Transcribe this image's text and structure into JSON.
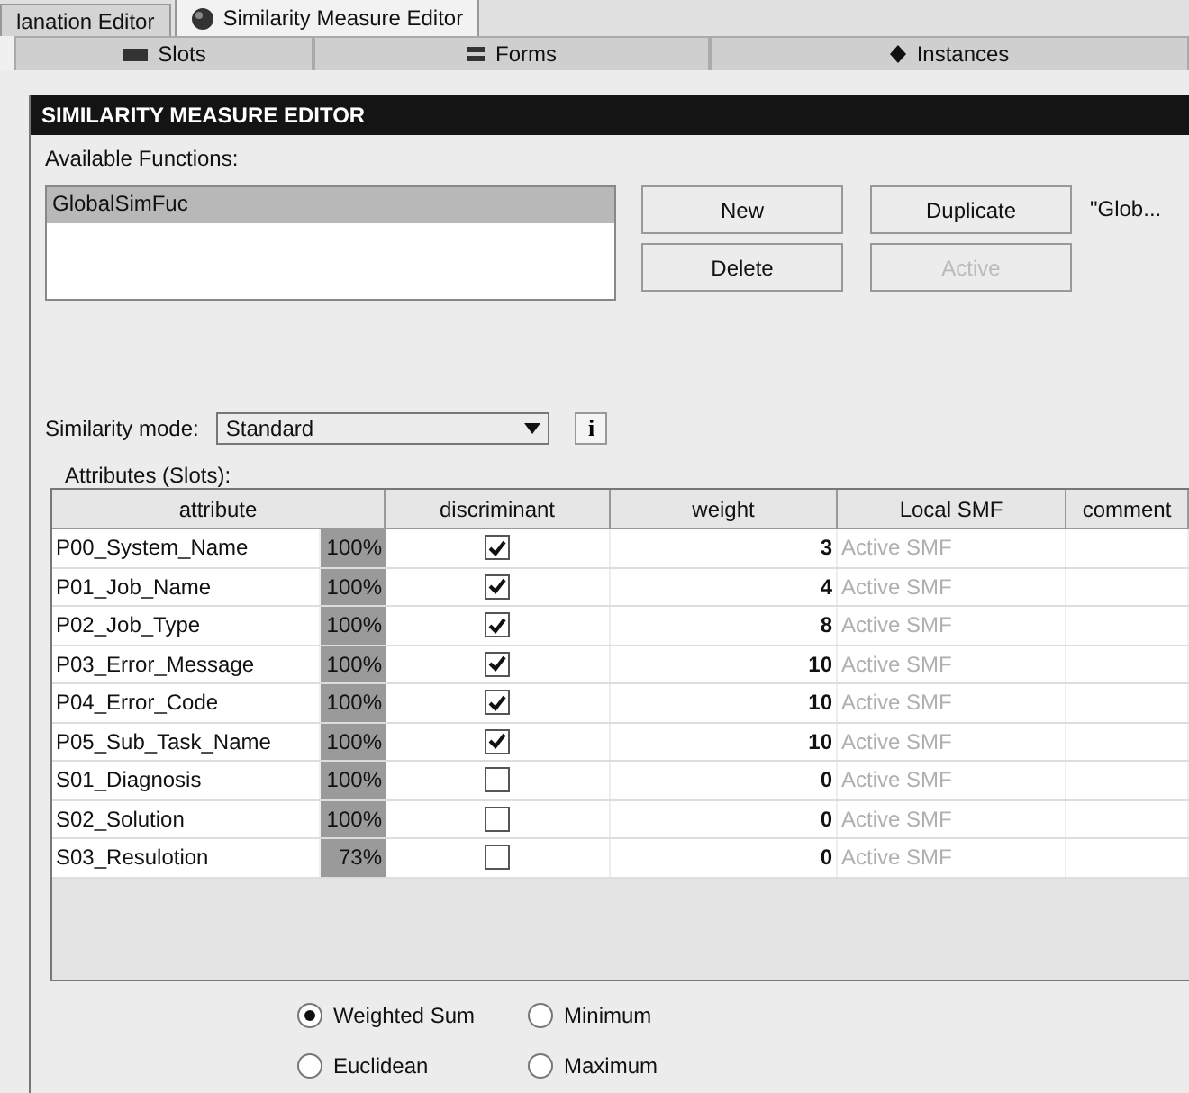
{
  "top_tabs": [
    {
      "label": "lanation Editor",
      "selected": false,
      "icon": false
    },
    {
      "label": "Similarity Measure Editor",
      "selected": true,
      "icon": true
    }
  ],
  "sub_tabs": [
    {
      "label": "Slots",
      "kind": "slots"
    },
    {
      "label": "Forms",
      "kind": "forms"
    },
    {
      "label": "Instances",
      "kind": "instances"
    }
  ],
  "panel": {
    "title": "SIMILARITY MEASURE EDITOR",
    "functions_label": "Available Functions:",
    "functions": [
      {
        "label": "GlobalSimFuc",
        "selected": true
      }
    ],
    "buttons": [
      {
        "label": "New",
        "disabled": false
      },
      {
        "label": "Duplicate",
        "disabled": false
      },
      {
        "label": "Delete",
        "disabled": false
      },
      {
        "label": "Active",
        "disabled": true
      }
    ],
    "active_function": "\"Glob...",
    "mode_label": "Similarity mode:",
    "mode_value": "Standard",
    "info_button": "i",
    "attributes_label": "Attributes (Slots):",
    "table": {
      "columns": [
        "attribute",
        "discriminant",
        "weight",
        "Local SMF",
        "comment"
      ],
      "rows": [
        {
          "attribute": "P00_System_Name",
          "percent": "100%",
          "discriminant": true,
          "weight": "3",
          "local_smf": "Active SMF"
        },
        {
          "attribute": "P01_Job_Name",
          "percent": "100%",
          "discriminant": true,
          "weight": "4",
          "local_smf": "Active SMF"
        },
        {
          "attribute": "P02_Job_Type",
          "percent": "100%",
          "discriminant": true,
          "weight": "8",
          "local_smf": "Active SMF"
        },
        {
          "attribute": "P03_Error_Message",
          "percent": "100%",
          "discriminant": true,
          "weight": "10",
          "local_smf": "Active SMF"
        },
        {
          "attribute": "P04_Error_Code",
          "percent": "100%",
          "discriminant": true,
          "weight": "10",
          "local_smf": "Active SMF"
        },
        {
          "attribute": "P05_Sub_Task_Name",
          "percent": "100%",
          "discriminant": true,
          "weight": "10",
          "local_smf": "Active SMF"
        },
        {
          "attribute": "S01_Diagnosis",
          "percent": "100%",
          "discriminant": false,
          "weight": "0",
          "local_smf": "Active SMF"
        },
        {
          "attribute": "S02_Solution",
          "percent": "100%",
          "discriminant": false,
          "weight": "0",
          "local_smf": "Active SMF"
        },
        {
          "attribute": "S03_Resulotion",
          "percent": "73%",
          "discriminant": false,
          "weight": "0",
          "local_smf": "Active SMF"
        }
      ]
    },
    "aggregation": [
      {
        "label": "Weighted Sum",
        "selected": true
      },
      {
        "label": "Minimum",
        "selected": false
      },
      {
        "label": "Euclidean",
        "selected": false
      },
      {
        "label": "Maximum",
        "selected": false
      }
    ]
  }
}
